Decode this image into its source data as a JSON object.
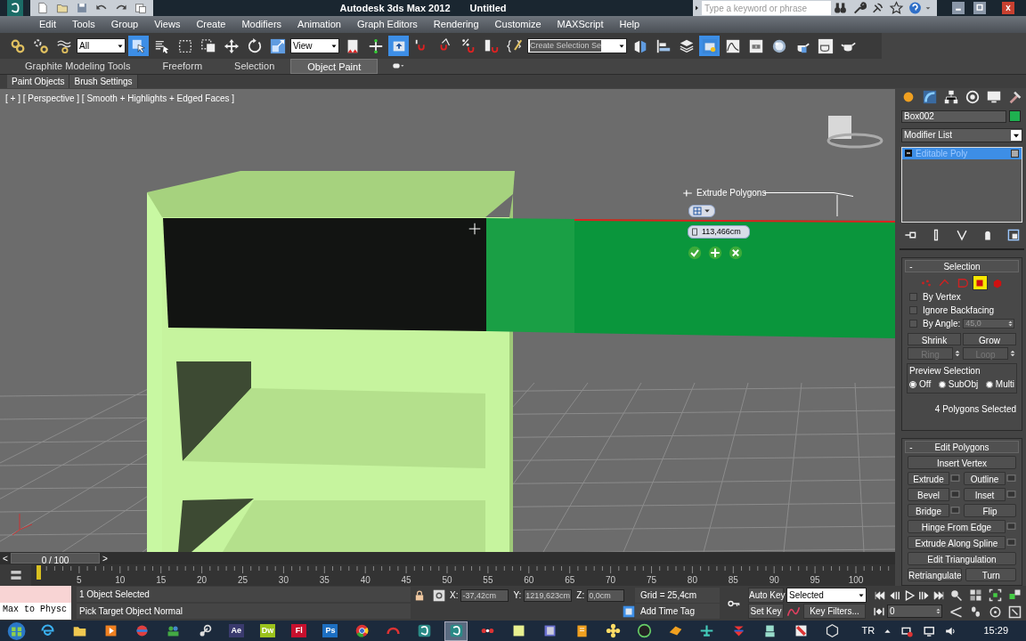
{
  "title_bar": {
    "title": "Autodesk 3ds Max  2012",
    "document": "Untitled",
    "search_placeholder": "Type a keyword or phrase"
  },
  "menu": [
    "Edit",
    "Tools",
    "Group",
    "Views",
    "Create",
    "Modifiers",
    "Animation",
    "Graph Editors",
    "Rendering",
    "Customize",
    "MAXScript",
    "Help"
  ],
  "toolbar": {
    "selection_filter": "All",
    "reference_coordinate": "View",
    "named_selection": "Create Selection Se",
    "tools": [
      {
        "kind": "link",
        "selected": false
      },
      {
        "kind": "unlink",
        "selected": false
      },
      {
        "kind": "bind",
        "selected": false
      },
      {
        "kind": "filter"
      },
      {
        "kind": "select",
        "selected": true
      },
      {
        "kind": "list",
        "selected": false
      },
      {
        "kind": "rect",
        "selected": false
      },
      {
        "kind": "window",
        "selected": false
      },
      {
        "kind": "move",
        "selected": false
      },
      {
        "kind": "rotate",
        "selected": false
      },
      {
        "kind": "scale",
        "selected": false
      },
      {
        "kind": "coord"
      },
      {
        "kind": "pivot",
        "selected": false
      },
      {
        "kind": "manip",
        "selected": false
      },
      {
        "kind": "keyboard",
        "selected": true
      },
      {
        "kind": "snap",
        "selected": false
      },
      {
        "kind": "angle",
        "selected": false
      },
      {
        "kind": "percent",
        "selected": false
      },
      {
        "kind": "spinner",
        "selected": false
      },
      {
        "kind": "named",
        "selected": false
      },
      {
        "kind": "named_set"
      },
      {
        "kind": "mirror",
        "selected": false
      },
      {
        "kind": "align",
        "selected": false
      },
      {
        "kind": "layers",
        "selected": false
      },
      {
        "kind": "explorer",
        "selected": true
      },
      {
        "kind": "curve",
        "selected": false
      },
      {
        "kind": "schematic",
        "selected": false
      },
      {
        "kind": "material",
        "selected": false
      },
      {
        "kind": "setup",
        "selected": false
      },
      {
        "kind": "frame",
        "selected": false
      },
      {
        "kind": "render",
        "selected": false
      }
    ]
  },
  "ribbon": {
    "tabs": [
      {
        "label": "Graphite Modeling Tools",
        "selected": false
      },
      {
        "label": "Freeform",
        "selected": false
      },
      {
        "label": "Selection",
        "selected": false
      },
      {
        "label": "Object Paint",
        "selected": true
      }
    ],
    "panels": [
      "Paint Objects",
      "Brush Settings"
    ]
  },
  "viewport": {
    "label": "[ + ] [ Perspective ] [ Smooth + Highlights + Edged Faces ]",
    "caddy": {
      "title": "Extrude Polygons",
      "value": "113,466cm"
    }
  },
  "command_panel": {
    "object_name": "Box002",
    "modifier_list": "Modifier List",
    "stack": [
      {
        "label": "Editable Poly",
        "selected": true
      }
    ],
    "selection": {
      "title": "Selection",
      "collapse_sign": "-",
      "levels": [
        {
          "kind": "vertex",
          "selected": false
        },
        {
          "kind": "edge",
          "selected": false
        },
        {
          "kind": "border",
          "selected": false
        },
        {
          "kind": "polygon",
          "selected": true
        },
        {
          "kind": "element",
          "selected": false
        }
      ],
      "checkboxes": [
        {
          "label": "By Vertex",
          "checked": false
        },
        {
          "label": "Ignore Backfacing",
          "checked": false
        },
        {
          "label": "By Angle:",
          "checked": false
        }
      ],
      "angle": "45,0",
      "buttons": [
        {
          "label": "Shrink",
          "disabled": false,
          "spinner": false
        },
        {
          "label": "Grow",
          "disabled": false,
          "spinner": false
        },
        {
          "label": "Ring",
          "disabled": true,
          "spinner": true
        },
        {
          "label": "Loop",
          "disabled": true,
          "spinner": true
        }
      ],
      "preview_title": "Preview Selection",
      "preview_options": [
        {
          "label": "Off",
          "selected": true
        },
        {
          "label": "SubObj",
          "selected": false
        },
        {
          "label": "Multi",
          "selected": false
        }
      ],
      "status": "4 Polygons Selected"
    },
    "edit_polygons": {
      "title": "Edit Polygons",
      "collapse_sign": "-",
      "rows": [
        [
          {
            "label": "Insert Vertex",
            "settings": false
          }
        ],
        [
          {
            "label": "Extrude",
            "settings": true
          },
          {
            "label": "Outline",
            "settings": true
          }
        ],
        [
          {
            "label": "Bevel",
            "settings": true
          },
          {
            "label": "Inset",
            "settings": true
          }
        ],
        [
          {
            "label": "Bridge",
            "settings": true
          },
          {
            "label": "Flip",
            "settings": false
          }
        ],
        [
          {
            "label": "Hinge From Edge",
            "settings": true
          }
        ],
        [
          {
            "label": "Extrude Along Spline",
            "settings": true
          }
        ],
        [
          {
            "label": "Edit Triangulation",
            "settings": false
          }
        ],
        [
          {
            "label": "Retriangulate",
            "settings": false
          },
          {
            "label": "Turn",
            "settings": false
          }
        ]
      ]
    }
  },
  "time_slider": {
    "label": "0 / 100",
    "level": 0,
    "prev": "<",
    "next": ">"
  },
  "track_labels": [
    "5",
    "10",
    "15",
    "20",
    "25",
    "30",
    "35",
    "40",
    "45",
    "50",
    "55",
    "60",
    "65",
    "70",
    "75",
    "80",
    "85",
    "90",
    "95",
    "100"
  ],
  "status": {
    "listener": "Max to Physc",
    "prompts": [
      "1 Object Selected",
      "Pick Target Object Normal"
    ],
    "coords": [
      {
        "axis": "X:",
        "value": "-37,42cm"
      },
      {
        "axis": "Y:",
        "value": "1219,623cm"
      },
      {
        "axis": "Z:",
        "value": "0,0cm"
      }
    ],
    "grid": "Grid = 25,4cm",
    "time_tag": "Add Time Tag",
    "auto_key": "Auto Key",
    "key_mode": "Selected",
    "set_key": "Set Key",
    "key_filters": "Key Filters...",
    "frame": "0"
  },
  "taskbar": {
    "apps": [
      {
        "kind": "ie",
        "selected": false
      },
      {
        "kind": "folder",
        "selected": false
      },
      {
        "kind": "media",
        "selected": false
      },
      {
        "kind": "ball",
        "selected": false
      },
      {
        "kind": "people",
        "selected": false
      },
      {
        "kind": "steam",
        "selected": false
      },
      {
        "kind": "tile",
        "label": "Ae",
        "color": "#3a3a6e",
        "selected": false
      },
      {
        "kind": "tile",
        "label": "Dw",
        "color": "#9bc21d",
        "selected": false
      },
      {
        "kind": "tile",
        "label": "Fl",
        "color": "#c8102e",
        "selected": false
      },
      {
        "kind": "tile",
        "label": "Ps",
        "color": "#1d6fc2",
        "selected": false
      },
      {
        "kind": "chrome",
        "selected": false
      },
      {
        "kind": "red",
        "selected": false
      },
      {
        "kind": "max",
        "selected": false
      },
      {
        "kind": "max",
        "selected": true
      },
      {
        "kind": "dots",
        "selected": false
      },
      {
        "kind": "note",
        "selected": false
      },
      {
        "kind": "book",
        "selected": false
      },
      {
        "kind": "notes",
        "selected": false
      },
      {
        "kind": "flower",
        "selected": false
      },
      {
        "kind": "gc",
        "selected": false
      },
      {
        "kind": "fox",
        "selected": false
      },
      {
        "kind": "plane",
        "selected": false
      },
      {
        "kind": "arrows",
        "selected": false
      },
      {
        "kind": "robot",
        "selected": false
      },
      {
        "kind": "torch",
        "selected": false
      },
      {
        "kind": "unity",
        "selected": false
      }
    ],
    "language": "TR",
    "clock": "15:29"
  }
}
